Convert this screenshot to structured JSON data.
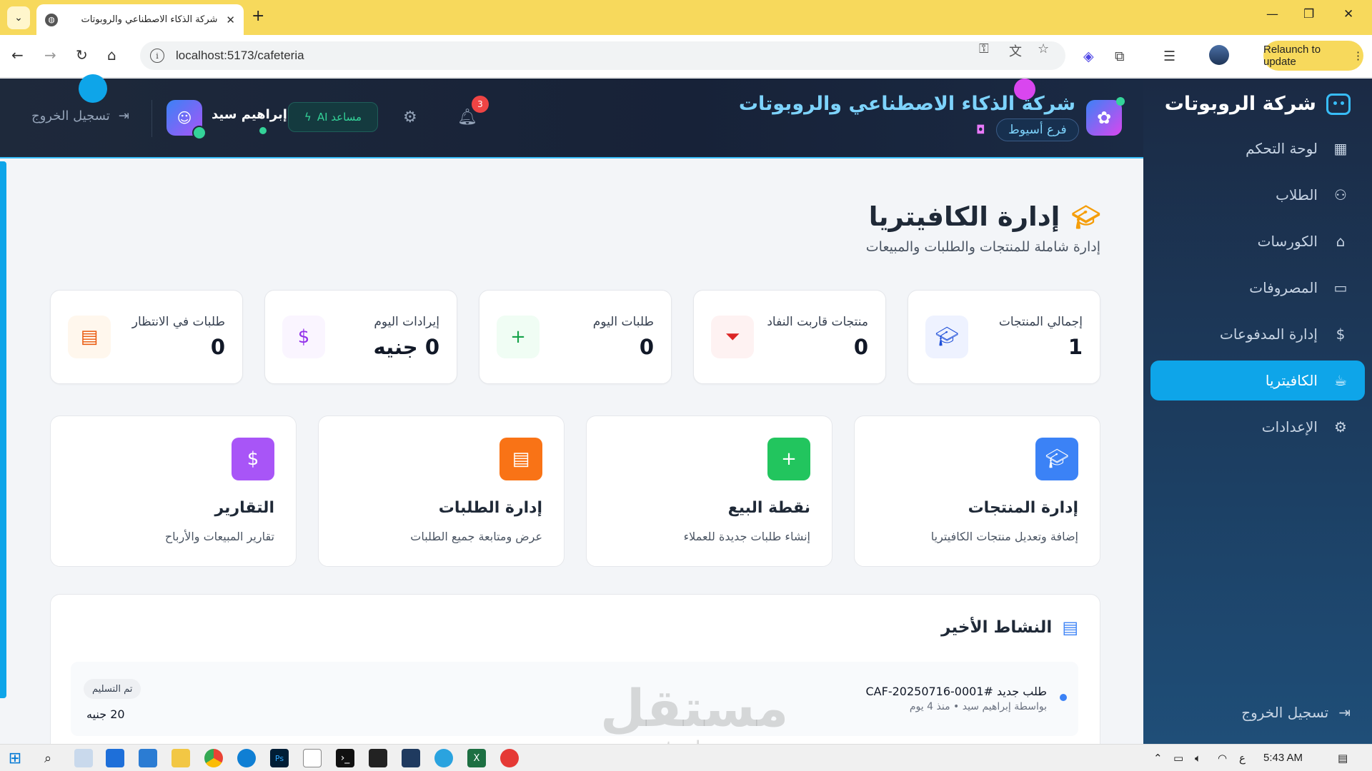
{
  "browser": {
    "tab_title": "شركة الذكاء الاصطناعي والروبوتات",
    "url": "localhost:5173/cafeteria",
    "relaunch_label": "Relaunch to update"
  },
  "sidebar": {
    "brand": "شركة الروبوتات",
    "items": [
      {
        "label": "لوحة التحكم",
        "icon": "grid-icon"
      },
      {
        "label": "الطلاب",
        "icon": "users-icon"
      },
      {
        "label": "الكورسات",
        "icon": "graduation-cap-icon"
      },
      {
        "label": "المصروفات",
        "icon": "wallet-icon"
      },
      {
        "label": "إدارة المدفوعات",
        "icon": "dollar-icon"
      },
      {
        "label": "الكافيتريا",
        "icon": "coffee-icon",
        "active": true
      },
      {
        "label": "الإعدادات",
        "icon": "gear-icon"
      }
    ],
    "logout": "تسجيل الخروج"
  },
  "header": {
    "company": "شركة الذكاء الاصطناعي والروبوتات",
    "branch": "فرع أسيوط",
    "notifications_count": "3",
    "ai_label": "مساعد AI",
    "user_name": "إبراهيم سيد",
    "logout": "تسجيل الخروج"
  },
  "page": {
    "title": "إدارة الكافيتريا",
    "subtitle": "إدارة شاملة للمنتجات والطلبات والمبيعات"
  },
  "stats": [
    {
      "label": "إجمالي المنتجات",
      "value": "1",
      "icon": "graduation-cap-icon",
      "bg": "#eef2ff",
      "fg": "#1d4ed8"
    },
    {
      "label": "منتجات قاربت النفاد",
      "value": "0",
      "icon": "filter-icon",
      "bg": "#fef2f2",
      "fg": "#dc2626"
    },
    {
      "label": "طلبات اليوم",
      "value": "0",
      "icon": "plus-icon",
      "bg": "#f0fdf4",
      "fg": "#16a34a"
    },
    {
      "label": "إيرادات اليوم",
      "value": "0 جنيه",
      "icon": "dollar-icon",
      "bg": "#faf5ff",
      "fg": "#9333ea"
    },
    {
      "label": "طلبات في الانتظار",
      "value": "0",
      "icon": "calendar-icon",
      "bg": "#fff7ed",
      "fg": "#ea580c"
    }
  ],
  "actions": [
    {
      "title": "إدارة المنتجات",
      "desc": "إضافة وتعديل منتجات الكافيتريا",
      "icon": "graduation-cap-icon",
      "color": "#3b82f6"
    },
    {
      "title": "نقطة البيع",
      "desc": "إنشاء طلبات جديدة للعملاء",
      "icon": "plus-icon",
      "color": "#22c55e"
    },
    {
      "title": "إدارة الطلبات",
      "desc": "عرض ومتابعة جميع الطلبات",
      "icon": "calendar-icon",
      "color": "#f97316"
    },
    {
      "title": "التقارير",
      "desc": "تقارير المبيعات والأرباح",
      "icon": "dollar-icon",
      "color": "#a855f7"
    }
  ],
  "activity": {
    "title": "النشاط الأخير",
    "items": [
      {
        "order": "طلب جديد #CAF-20250716-0001",
        "by": "بواسطة إبراهيم سيد • منذ 4 يوم",
        "status": "تم التسليم",
        "amount": "20 جنيه"
      }
    ]
  },
  "watermark": {
    "logo": "مستقل",
    "url": "mostaql.com"
  },
  "taskbar": {
    "time": "5:43 AM",
    "lang": "ع"
  }
}
